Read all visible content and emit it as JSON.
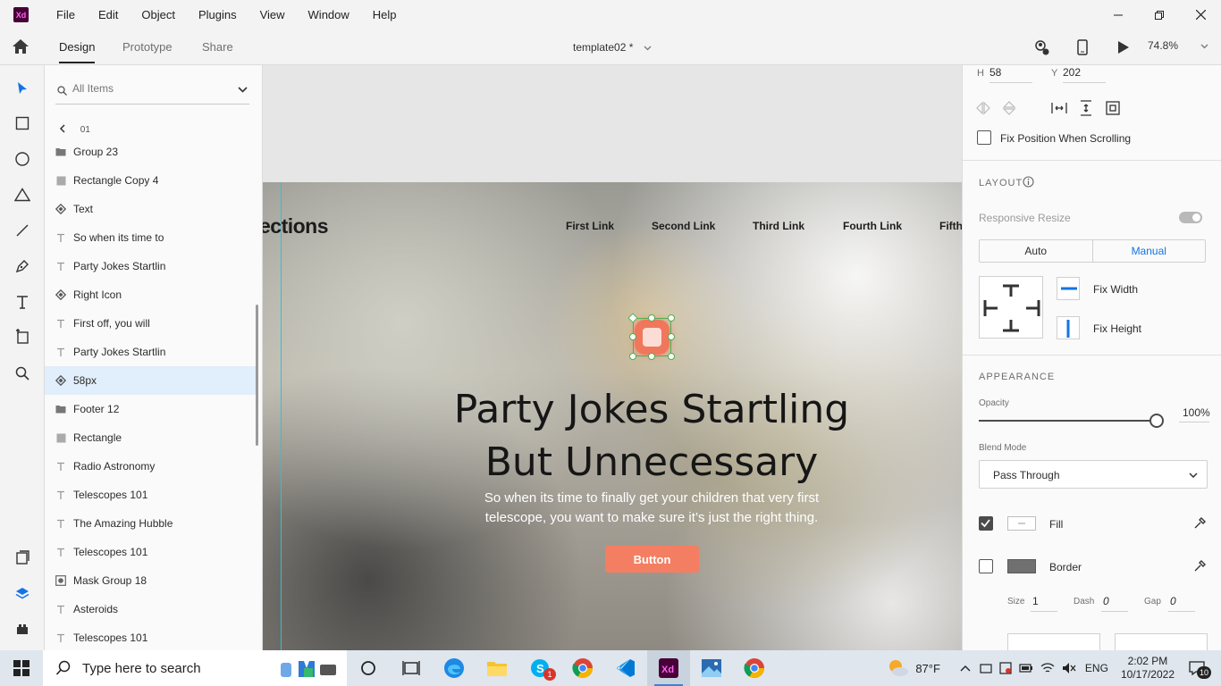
{
  "app": {
    "logo": "Xd",
    "menus": [
      "File",
      "Edit",
      "Object",
      "Plugins",
      "View",
      "Window",
      "Help"
    ]
  },
  "toolbar": {
    "tabs": [
      "Design",
      "Prototype",
      "Share"
    ],
    "doc_title": "template02 *",
    "zoom": "74.8%"
  },
  "layers": {
    "search_placeholder": "All Items",
    "crumb": "01",
    "items": [
      {
        "label": "Group 23",
        "icon": "folder-icon"
      },
      {
        "label": "Rectangle Copy 4",
        "icon": "rectangle-icon"
      },
      {
        "label": "Text",
        "icon": "component-icon"
      },
      {
        "label": "So when its time to",
        "icon": "text-icon"
      },
      {
        "label": "Party Jokes Startlin",
        "icon": "text-icon"
      },
      {
        "label": "Right Icon",
        "icon": "component-icon"
      },
      {
        "label": "First off, you will",
        "icon": "text-icon"
      },
      {
        "label": "Party Jokes Startlin",
        "icon": "text-icon"
      },
      {
        "label": "58px",
        "icon": "component-icon",
        "selected": true
      },
      {
        "label": "Footer 12",
        "icon": "folder-icon"
      },
      {
        "label": "Rectangle",
        "icon": "rectangle-icon"
      },
      {
        "label": "Radio Astronomy",
        "icon": "text-icon"
      },
      {
        "label": "Telescopes 101",
        "icon": "text-icon"
      },
      {
        "label": "The Amazing Hubble",
        "icon": "text-icon"
      },
      {
        "label": "Telescopes 101",
        "icon": "text-icon"
      },
      {
        "label": "Mask Group 18",
        "icon": "mask-icon"
      },
      {
        "label": "Asteroids",
        "icon": "text-icon"
      },
      {
        "label": "Telescopes 101",
        "icon": "text-icon"
      }
    ]
  },
  "artboard": {
    "brand": "ections",
    "nav": [
      "First Link",
      "Second Link",
      "Third Link",
      "Fourth Link",
      "Fifth"
    ],
    "title_line1": "Party Jokes Startling",
    "title_line2": "But Unnecessary",
    "sub_line1": "So when its time to finally get your children that very first",
    "sub_line2": "telescope, you want to make sure it’s just the right thing.",
    "button": "Button",
    "accent": "#f47e62"
  },
  "inspector": {
    "h_label": "H",
    "h_value": "58",
    "y_label": "Y",
    "y_value": "202",
    "fix_position": "Fix Position When Scrolling",
    "layout_title": "LAYOUT",
    "responsive_resize": "Responsive Resize",
    "seg_auto": "Auto",
    "seg_manual": "Manual",
    "fix_width": "Fix Width",
    "fix_height": "Fix Height",
    "appearance_title": "APPEARANCE",
    "opacity_label": "Opacity",
    "opacity_value": "100%",
    "blend_label": "Blend Mode",
    "blend_value": "Pass Through",
    "fill_label": "Fill",
    "border_label": "Border",
    "size_label": "Size",
    "size_value": "1",
    "dash_label": "Dash",
    "dash_value": "0",
    "gap_label": "Gap",
    "gap_value": "0"
  },
  "taskbar": {
    "search_placeholder": "Type here to search",
    "weather": "87°F",
    "lang": "ENG",
    "time": "2:02 PM",
    "date": "10/17/2022",
    "notif_count": "10",
    "skype_badge": "1"
  }
}
